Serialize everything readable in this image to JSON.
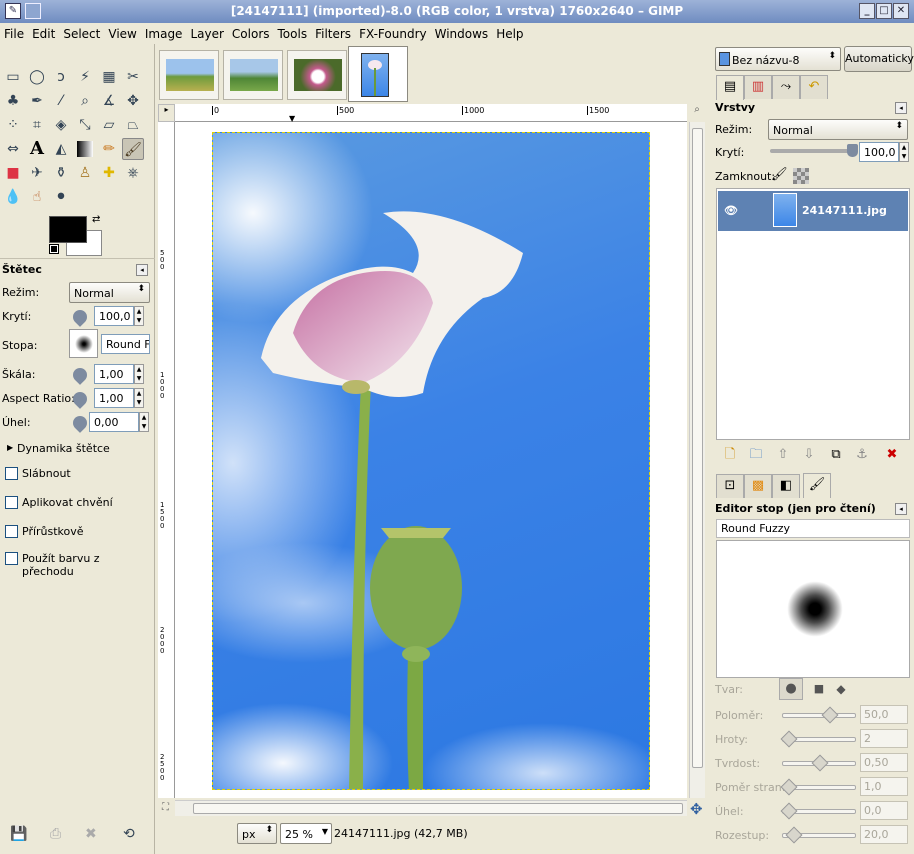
{
  "window": {
    "title": "[24147111] (imported)-8.0 (RGB color, 1 vrstva) 1760x2640 – GIMP"
  },
  "menu": [
    "File",
    "Edit",
    "Select",
    "View",
    "Image",
    "Layer",
    "Colors",
    "Tools",
    "Filters",
    "FX-Foundry",
    "Windows",
    "Help"
  ],
  "toolbox": {
    "panel_title": "Štětec",
    "mode_label": "Režim:",
    "mode_value": "Normal",
    "opacity_label": "Krytí:",
    "opacity_value": "100,0",
    "brush_label": "Stopa:",
    "brush_value": "Round Fu",
    "scale_label": "Škála:",
    "scale_value": "1,00",
    "aspect_label": "Aspect Ratio:",
    "aspect_value": "1,00",
    "angle_label": "Úhel:",
    "angle_value": "0,00",
    "dynamics_label": "Dynamika štětce",
    "checks": [
      "Slábnout",
      "Aplikovat chvění",
      "Přírůstkově",
      "Použít barvu z přechodu"
    ]
  },
  "ruler": {
    "h_ticks": [
      "0",
      "500",
      "1000",
      "1500"
    ],
    "v_ticks": [
      "500",
      "1000",
      "1500",
      "2000",
      "2500"
    ]
  },
  "status": {
    "unit": "px",
    "zoom": "25 %",
    "info": "24147111.jpg (42,7 MB)"
  },
  "layers": {
    "image_select": "Bez názvu-8",
    "auto_button": "Automaticky",
    "panel_title": "Vrstvy",
    "mode_label": "Režim:",
    "mode_value": "Normal",
    "opacity_label": "Krytí:",
    "opacity_value": "100,0",
    "lock_label": "Zamknout:",
    "layer_name": "24147111.jpg"
  },
  "brush_editor": {
    "panel_title": "Editor stop (jen pro čtení)",
    "brush_name": "Round Fuzzy",
    "shape_label": "Tvar:",
    "params": [
      {
        "label": "Poloměr:",
        "value": "50,0",
        "level": 0.6
      },
      {
        "label": "Hroty:",
        "value": "2",
        "level": 0.0
      },
      {
        "label": "Tvrdost:",
        "value": "0,50",
        "level": 0.5
      },
      {
        "label": "Poměr stran:",
        "value": "1,0",
        "level": 0.0
      },
      {
        "label": "Úhel:",
        "value": "0,0",
        "level": 0.0
      },
      {
        "label": "Rozestup:",
        "value": "20,0",
        "level": 0.1
      }
    ]
  },
  "colors": {
    "selected_layer": "#5e82b3",
    "sky": "#3b82e6",
    "titlebar": "#7f99c8"
  }
}
